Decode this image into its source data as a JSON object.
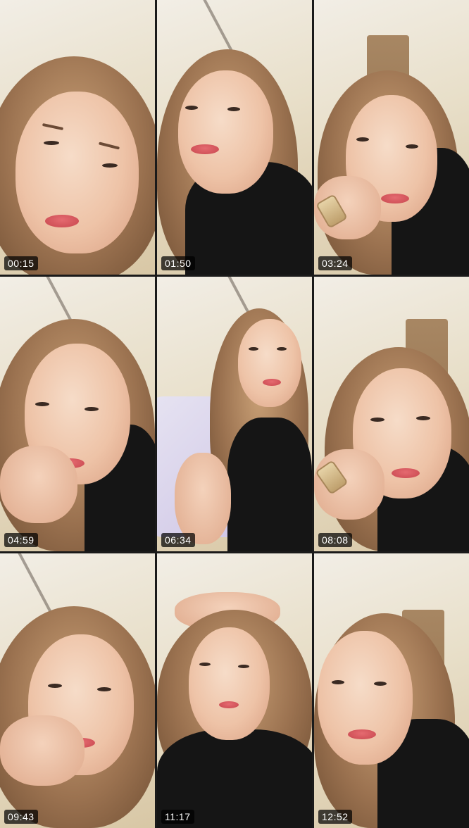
{
  "thumbnails": [
    {
      "timestamp": "00:15"
    },
    {
      "timestamp": "01:50"
    },
    {
      "timestamp": "03:24"
    },
    {
      "timestamp": "04:59"
    },
    {
      "timestamp": "06:34"
    },
    {
      "timestamp": "08:08"
    },
    {
      "timestamp": "09:43"
    },
    {
      "timestamp": "11:17"
    },
    {
      "timestamp": "12:52"
    }
  ]
}
